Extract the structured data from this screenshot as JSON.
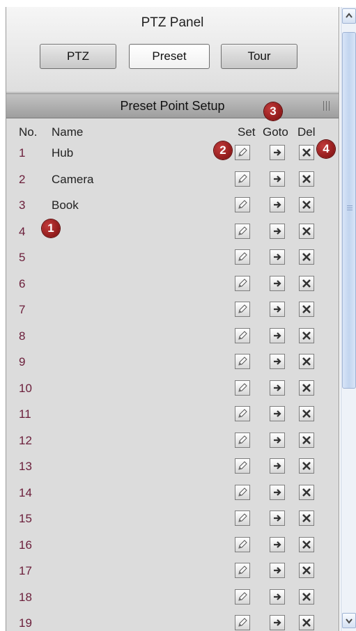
{
  "panel": {
    "title": "PTZ Panel",
    "tabs": [
      "PTZ",
      "Preset",
      "Tour"
    ],
    "active_tab": "Preset"
  },
  "section": {
    "title": "Preset Point Setup"
  },
  "columns": {
    "no": "No.",
    "name": "Name",
    "set": "Set",
    "goto": "Goto",
    "del": "Del"
  },
  "presets": [
    {
      "no": "1",
      "name": "Hub"
    },
    {
      "no": "2",
      "name": "Camera"
    },
    {
      "no": "3",
      "name": "Book"
    },
    {
      "no": "4",
      "name": ""
    },
    {
      "no": "5",
      "name": ""
    },
    {
      "no": "6",
      "name": ""
    },
    {
      "no": "7",
      "name": ""
    },
    {
      "no": "8",
      "name": ""
    },
    {
      "no": "9",
      "name": ""
    },
    {
      "no": "10",
      "name": ""
    },
    {
      "no": "11",
      "name": ""
    },
    {
      "no": "12",
      "name": ""
    },
    {
      "no": "13",
      "name": ""
    },
    {
      "no": "14",
      "name": ""
    },
    {
      "no": "15",
      "name": ""
    },
    {
      "no": "16",
      "name": ""
    },
    {
      "no": "17",
      "name": ""
    },
    {
      "no": "18",
      "name": ""
    },
    {
      "no": "19",
      "name": ""
    }
  ],
  "annotations": [
    "1",
    "2",
    "3",
    "4"
  ],
  "icons": {
    "set": "pencil-icon",
    "goto": "arrow-right-icon",
    "del": "close-x-icon"
  },
  "colors": {
    "row_number": "#6b1e3a",
    "badge": "#8b1010"
  }
}
